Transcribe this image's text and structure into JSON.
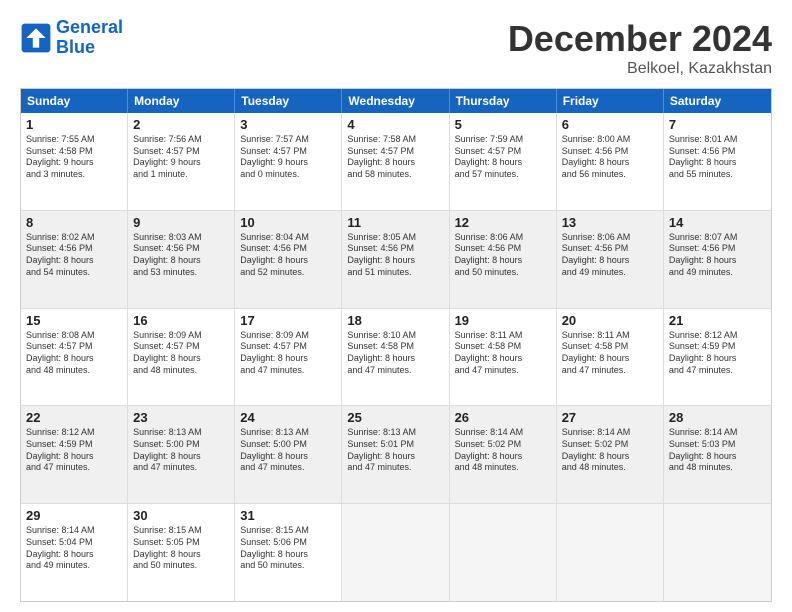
{
  "logo": {
    "line1": "General",
    "line2": "Blue"
  },
  "title": "December 2024",
  "subtitle": "Belkoel, Kazakhstan",
  "days": [
    "Sunday",
    "Monday",
    "Tuesday",
    "Wednesday",
    "Thursday",
    "Friday",
    "Saturday"
  ],
  "weeks": [
    [
      {
        "day": "1",
        "info": "Sunrise: 7:55 AM\nSunset: 4:58 PM\nDaylight: 9 hours\nand 3 minutes.",
        "shaded": false
      },
      {
        "day": "2",
        "info": "Sunrise: 7:56 AM\nSunset: 4:57 PM\nDaylight: 9 hours\nand 1 minute.",
        "shaded": false
      },
      {
        "day": "3",
        "info": "Sunrise: 7:57 AM\nSunset: 4:57 PM\nDaylight: 9 hours\nand 0 minutes.",
        "shaded": false
      },
      {
        "day": "4",
        "info": "Sunrise: 7:58 AM\nSunset: 4:57 PM\nDaylight: 8 hours\nand 58 minutes.",
        "shaded": false
      },
      {
        "day": "5",
        "info": "Sunrise: 7:59 AM\nSunset: 4:57 PM\nDaylight: 8 hours\nand 57 minutes.",
        "shaded": false
      },
      {
        "day": "6",
        "info": "Sunrise: 8:00 AM\nSunset: 4:56 PM\nDaylight: 8 hours\nand 56 minutes.",
        "shaded": false
      },
      {
        "day": "7",
        "info": "Sunrise: 8:01 AM\nSunset: 4:56 PM\nDaylight: 8 hours\nand 55 minutes.",
        "shaded": false
      }
    ],
    [
      {
        "day": "8",
        "info": "Sunrise: 8:02 AM\nSunset: 4:56 PM\nDaylight: 8 hours\nand 54 minutes.",
        "shaded": true
      },
      {
        "day": "9",
        "info": "Sunrise: 8:03 AM\nSunset: 4:56 PM\nDaylight: 8 hours\nand 53 minutes.",
        "shaded": true
      },
      {
        "day": "10",
        "info": "Sunrise: 8:04 AM\nSunset: 4:56 PM\nDaylight: 8 hours\nand 52 minutes.",
        "shaded": true
      },
      {
        "day": "11",
        "info": "Sunrise: 8:05 AM\nSunset: 4:56 PM\nDaylight: 8 hours\nand 51 minutes.",
        "shaded": true
      },
      {
        "day": "12",
        "info": "Sunrise: 8:06 AM\nSunset: 4:56 PM\nDaylight: 8 hours\nand 50 minutes.",
        "shaded": true
      },
      {
        "day": "13",
        "info": "Sunrise: 8:06 AM\nSunset: 4:56 PM\nDaylight: 8 hours\nand 49 minutes.",
        "shaded": true
      },
      {
        "day": "14",
        "info": "Sunrise: 8:07 AM\nSunset: 4:56 PM\nDaylight: 8 hours\nand 49 minutes.",
        "shaded": true
      }
    ],
    [
      {
        "day": "15",
        "info": "Sunrise: 8:08 AM\nSunset: 4:57 PM\nDaylight: 8 hours\nand 48 minutes.",
        "shaded": false
      },
      {
        "day": "16",
        "info": "Sunrise: 8:09 AM\nSunset: 4:57 PM\nDaylight: 8 hours\nand 48 minutes.",
        "shaded": false
      },
      {
        "day": "17",
        "info": "Sunrise: 8:09 AM\nSunset: 4:57 PM\nDaylight: 8 hours\nand 47 minutes.",
        "shaded": false
      },
      {
        "day": "18",
        "info": "Sunrise: 8:10 AM\nSunset: 4:58 PM\nDaylight: 8 hours\nand 47 minutes.",
        "shaded": false
      },
      {
        "day": "19",
        "info": "Sunrise: 8:11 AM\nSunset: 4:58 PM\nDaylight: 8 hours\nand 47 minutes.",
        "shaded": false
      },
      {
        "day": "20",
        "info": "Sunrise: 8:11 AM\nSunset: 4:58 PM\nDaylight: 8 hours\nand 47 minutes.",
        "shaded": false
      },
      {
        "day": "21",
        "info": "Sunrise: 8:12 AM\nSunset: 4:59 PM\nDaylight: 8 hours\nand 47 minutes.",
        "shaded": false
      }
    ],
    [
      {
        "day": "22",
        "info": "Sunrise: 8:12 AM\nSunset: 4:59 PM\nDaylight: 8 hours\nand 47 minutes.",
        "shaded": true
      },
      {
        "day": "23",
        "info": "Sunrise: 8:13 AM\nSunset: 5:00 PM\nDaylight: 8 hours\nand 47 minutes.",
        "shaded": true
      },
      {
        "day": "24",
        "info": "Sunrise: 8:13 AM\nSunset: 5:00 PM\nDaylight: 8 hours\nand 47 minutes.",
        "shaded": true
      },
      {
        "day": "25",
        "info": "Sunrise: 8:13 AM\nSunset: 5:01 PM\nDaylight: 8 hours\nand 47 minutes.",
        "shaded": true
      },
      {
        "day": "26",
        "info": "Sunrise: 8:14 AM\nSunset: 5:02 PM\nDaylight: 8 hours\nand 48 minutes.",
        "shaded": true
      },
      {
        "day": "27",
        "info": "Sunrise: 8:14 AM\nSunset: 5:02 PM\nDaylight: 8 hours\nand 48 minutes.",
        "shaded": true
      },
      {
        "day": "28",
        "info": "Sunrise: 8:14 AM\nSunset: 5:03 PM\nDaylight: 8 hours\nand 48 minutes.",
        "shaded": true
      }
    ],
    [
      {
        "day": "29",
        "info": "Sunrise: 8:14 AM\nSunset: 5:04 PM\nDaylight: 8 hours\nand 49 minutes.",
        "shaded": false
      },
      {
        "day": "30",
        "info": "Sunrise: 8:15 AM\nSunset: 5:05 PM\nDaylight: 8 hours\nand 50 minutes.",
        "shaded": false
      },
      {
        "day": "31",
        "info": "Sunrise: 8:15 AM\nSunset: 5:06 PM\nDaylight: 8 hours\nand 50 minutes.",
        "shaded": false
      },
      {
        "day": "",
        "info": "",
        "shaded": false,
        "empty": true
      },
      {
        "day": "",
        "info": "",
        "shaded": false,
        "empty": true
      },
      {
        "day": "",
        "info": "",
        "shaded": false,
        "empty": true
      },
      {
        "day": "",
        "info": "",
        "shaded": false,
        "empty": true
      }
    ]
  ]
}
